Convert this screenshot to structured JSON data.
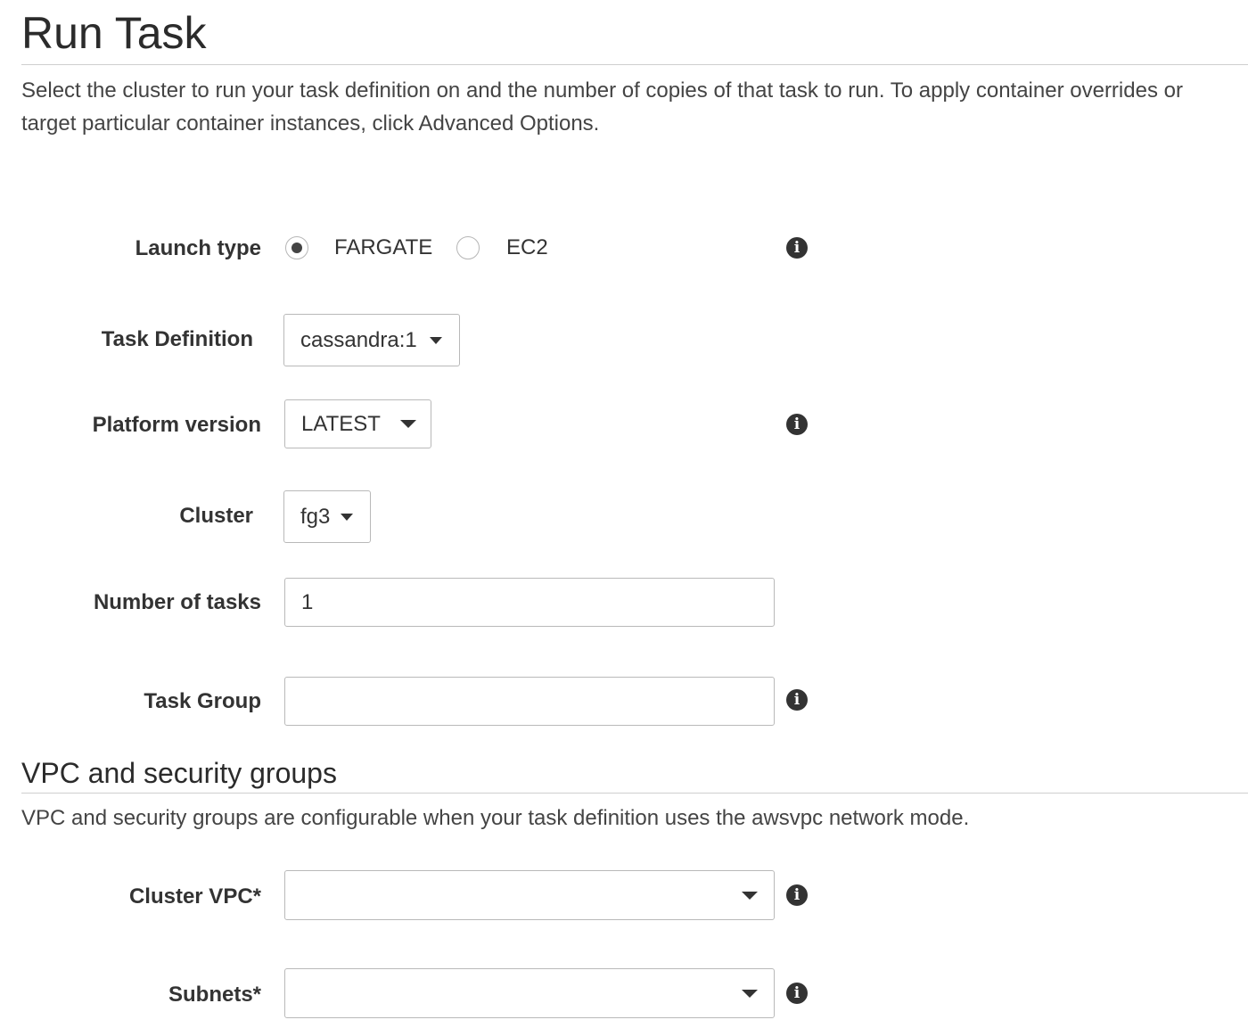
{
  "page": {
    "title": "Run Task",
    "description": "Select the cluster to run your task definition on and the number of copies of that task to run. To apply container overrides or target particular container instances, click Advanced Options."
  },
  "icons": {
    "info": "info-icon",
    "info_glyph": "i"
  },
  "form": {
    "launch_type": {
      "label": "Launch type",
      "options": [
        "FARGATE",
        "EC2"
      ],
      "selected": "FARGATE"
    },
    "task_definition": {
      "label": "Task Definition",
      "value": "cassandra:1"
    },
    "platform_version": {
      "label": "Platform version",
      "value": "LATEST"
    },
    "cluster": {
      "label": "Cluster",
      "value": "fg3"
    },
    "number_of_tasks": {
      "label": "Number of tasks",
      "value": "1"
    },
    "task_group": {
      "label": "Task Group",
      "value": ""
    }
  },
  "vpc_section": {
    "title": "VPC and security groups",
    "description": "VPC and security groups are configurable when your task definition uses the awsvpc network mode.",
    "cluster_vpc": {
      "label": "Cluster VPC*",
      "value": ""
    },
    "subnets": {
      "label": "Subnets*",
      "value": ""
    }
  }
}
